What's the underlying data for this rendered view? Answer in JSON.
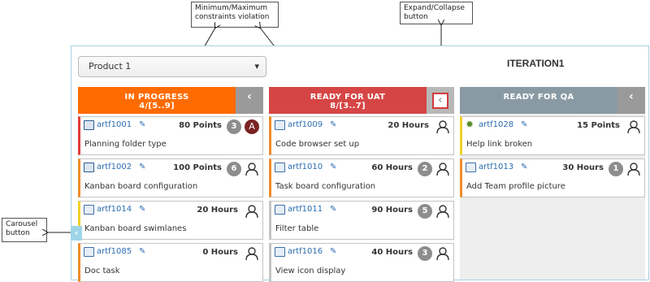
{
  "callouts": {
    "minmax": "Minimum/Maximum constraints violation",
    "expand": "Expand/Collapse button",
    "carousel": "Carousel button"
  },
  "toolbar": {
    "product_value": "Product 1",
    "product_caret": "▾"
  },
  "iteration": {
    "title": "ITERATION1"
  },
  "columns": [
    {
      "title": "IN PROGRESS",
      "subtitle": "4/[5..9]",
      "color": "#ff6b00",
      "toggle_color": "#9a9a9a",
      "cards": [
        {
          "icon": "book-icon",
          "id": "artf1001",
          "estimate": "80 Points",
          "badge": "3",
          "assignee": "A",
          "title": "Planning folder type",
          "accent": "#e43b3b"
        },
        {
          "icon": "book-icon",
          "id": "artf1002",
          "estimate": "100 Points",
          "badge": "6",
          "assignee": "",
          "title": "Kanban board configuration",
          "accent": "#f08b2a"
        },
        {
          "icon": "document-icon",
          "id": "artf1014",
          "estimate": "20 Hours",
          "badge": "",
          "assignee": "",
          "title": "Kanban board swimlanes",
          "accent": "#f0d12a"
        },
        {
          "icon": "document-icon",
          "id": "artf1085",
          "estimate": "0 Hours",
          "badge": "",
          "assignee": "",
          "title": "Doc task",
          "accent": "#f08b2a"
        }
      ]
    },
    {
      "title": "READY FOR UAT",
      "subtitle": "8/[3..7]",
      "color": "#d64545",
      "toggle_color": "#b8b8b8",
      "cards": [
        {
          "icon": "document-icon",
          "id": "artf1009",
          "estimate": "20 Hours",
          "badge": "",
          "assignee": "",
          "title": "Code browser set up",
          "accent": "#f08b2a"
        },
        {
          "icon": "document-icon",
          "id": "artf1010",
          "estimate": "60 Hours",
          "badge": "2",
          "assignee": "",
          "title": "Task board configuration",
          "accent": "#f08b2a"
        },
        {
          "icon": "document-icon",
          "id": "artf1011",
          "estimate": "90 Hours",
          "badge": "5",
          "assignee": "",
          "title": "Filter table",
          "accent": "#c4c4c4"
        },
        {
          "icon": "document-icon",
          "id": "artf1016",
          "estimate": "40 Hours",
          "badge": "3",
          "assignee": "",
          "title": "View icon display",
          "accent": "#c4c4c4"
        }
      ]
    },
    {
      "title": "READY FOR QA",
      "subtitle": "",
      "color": "#8a9aa5",
      "toggle_color": "#9a9a9a",
      "cards": [
        {
          "icon": "bug-icon",
          "id": "artf1028",
          "estimate": "15 Points",
          "badge": "",
          "assignee": "",
          "title": "Help link broken",
          "accent": "#f0d12a"
        },
        {
          "icon": "document-icon",
          "id": "artf1013",
          "estimate": "30 Hours",
          "badge": "1",
          "assignee": "",
          "title": "Add Team profile picture",
          "accent": "#f08b2a"
        }
      ]
    }
  ],
  "carousel": {
    "glyph": "‹"
  },
  "toggle_glyph": "‹"
}
